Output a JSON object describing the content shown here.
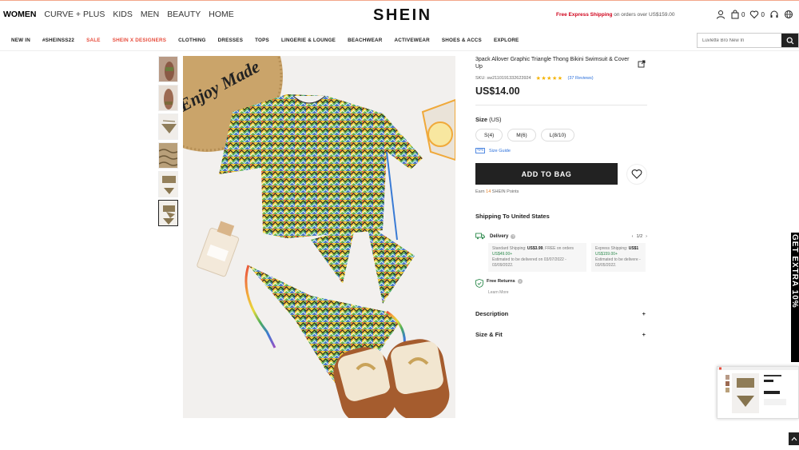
{
  "header": {
    "categories": [
      "WOMEN",
      "CURVE + PLUS",
      "KIDS",
      "MEN",
      "BEAUTY",
      "HOME"
    ],
    "logo": "SHEIN",
    "promo_bold": "Free Express Shipping",
    "promo_rest": " on orders over US$159.00",
    "bag_count": "0",
    "wishlist_count": "0"
  },
  "nav": {
    "items": [
      "NEW IN",
      "#SHEINSS22",
      "SALE",
      "SHEIN X DESIGNERS",
      "CLOTHING",
      "DRESSES",
      "TOPS",
      "LINGERIE & LOUNGE",
      "BEACHWEAR",
      "ACTIVEWEAR",
      "SHOES & ACCS",
      "EXPLORE"
    ],
    "search_value": "Luvlette Bro New In"
  },
  "product": {
    "title": "3pack Allover Graphic Triangle Thong Bikini Swimsuit & Cover Up",
    "sku_label": "SKU: sw2110191332623924",
    "stars": "★★★★★",
    "reviews": "(37 Reviews)",
    "price": "US$14.00",
    "image_text": "Enjoy Made",
    "size_label": "Size",
    "size_unit": " (US)",
    "sizes": [
      "S(4)",
      "M(6)",
      "L(8/10)"
    ],
    "size_guide": "Size Guide",
    "add_to_bag": "ADD TO BAG",
    "earn_prefix": "Earn ",
    "earn_points": "14",
    "earn_suffix": " SHEIN Points"
  },
  "shipping": {
    "title": "Shipping To United States",
    "delivery_label": "Delivery",
    "pager": "1/2",
    "standard": {
      "prefix": "Standard Shipping: ",
      "price": "US$3.99",
      "mid": ", FREE on orders ",
      "threshold": "US$49.00+",
      "estimate": "Estimated to be delivered on 03/07/2022 - 03/09/2022."
    },
    "express": {
      "prefix": "Express Shipping: ",
      "price": "US$1",
      "threshold": "US$159.00+",
      "estimate": "Estimated to be delivere - 03/05/2022."
    },
    "returns_label": "Free Returns",
    "learn_more": "Learn More"
  },
  "accordion": {
    "description": "Description",
    "size_fit": "Size & Fit",
    "toggle": "+"
  },
  "side_banner": "GET EXTRA 10%",
  "colors": {
    "accent_red": "#d0021b",
    "link_blue": "#2a6fdb",
    "star_gold": "#f5b301",
    "button_dark": "#222222"
  }
}
